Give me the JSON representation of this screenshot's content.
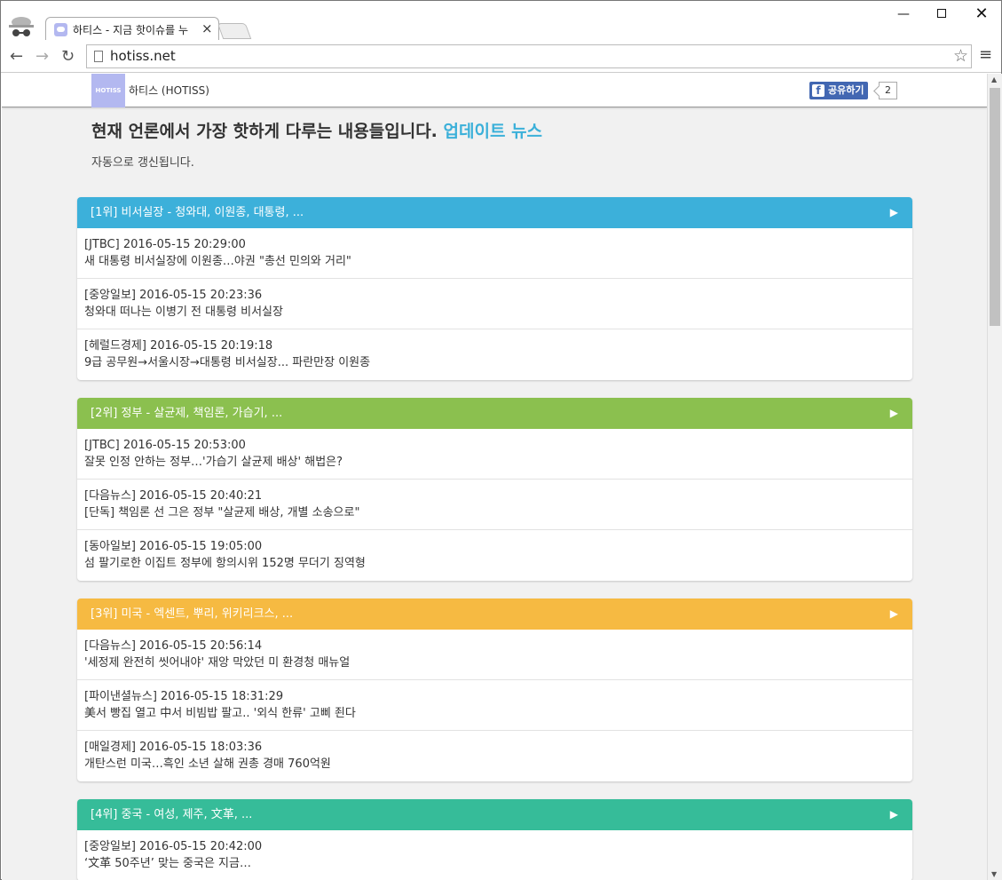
{
  "browser": {
    "tab_title": "하티스 - 지금 핫이슈를 누",
    "url": "hotiss.net",
    "nav_back": "←",
    "nav_forward": "→",
    "reload": "↻",
    "tab_close": "×",
    "win_min": "—",
    "win_close": "✕",
    "star": "☆",
    "menu": "≡"
  },
  "site": {
    "logo_text": "HOTISS",
    "name": "하티스 (HOTISS)",
    "fb_share_label": "공유하기",
    "fb_count": "2",
    "headline": "현재 언론에서 가장 핫하게 다루는 내용들입니다.",
    "headline_accent": "업데이트 뉴스",
    "subtitle": "자동으로 갱신됩니다."
  },
  "colors": {
    "blue": "#3cb0da",
    "green": "#8bc04f",
    "yellow": "#f6ba42",
    "teal": "#36bc99"
  },
  "cards": [
    {
      "title": "[1위] 비서실장 - 청와대, 이원종, 대통령, ...",
      "items": [
        {
          "meta": "[JTBC] 2016-05-15 20:29:00",
          "title": "새 대통령 비서실장에 이원종…야권 \"총선 민의와 거리\""
        },
        {
          "meta": "[중앙일보] 2016-05-15 20:23:36",
          "title": "청와대 떠나는 이병기 전 대통령 비서실장"
        },
        {
          "meta": "[헤럴드경제] 2016-05-15 20:19:18",
          "title": "9급 공무원→서울시장→대통령 비서실장... 파란만장 이원종"
        }
      ]
    },
    {
      "title": "[2위] 정부 - 살균제, 책임론, 가습기, ...",
      "items": [
        {
          "meta": "[JTBC] 2016-05-15 20:53:00",
          "title": "잘못 인정 안하는 정부…'가습기 살균제 배상' 해법은?"
        },
        {
          "meta": "[다음뉴스] 2016-05-15 20:40:21",
          "title": "[단독] 책임론 선 그은 정부 \"살균제 배상, 개별 소송으로\""
        },
        {
          "meta": "[동아일보] 2016-05-15 19:05:00",
          "title": "섬 팔기로한 이집트 정부에 항의시위 152명 무더기 징역형"
        }
      ]
    },
    {
      "title": "[3위] 미국 - 엑센트, 뿌리, 위키리크스, ...",
      "items": [
        {
          "meta": "[다음뉴스] 2016-05-15 20:56:14",
          "title": "'세정제 완전히 씻어내야' 재앙 막았던 미 환경청 매뉴얼"
        },
        {
          "meta": "[파이낸셜뉴스] 2016-05-15 18:31:29",
          "title": "美서 빵집 열고 中서 비빔밥 팔고.. '외식 한류' 고삐 죈다"
        },
        {
          "meta": "[매일경제] 2016-05-15 18:03:36",
          "title": "개탄스런 미국…흑인 소년 살해 권총 경매 760억원"
        }
      ]
    },
    {
      "title": "[4위] 중국 - 여성, 제주, 文革, ...",
      "items": [
        {
          "meta": "[중앙일보] 2016-05-15 20:42:00",
          "title": "‘文革 50주년’ 맞는 중국은 지금…"
        }
      ]
    }
  ]
}
